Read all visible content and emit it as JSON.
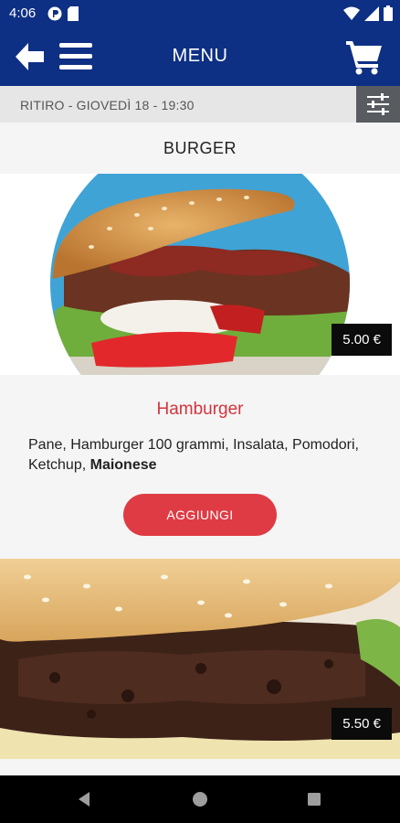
{
  "status_bar": {
    "time": "4:06",
    "left_icons": [
      "notification-icon",
      "sd-card-icon"
    ],
    "right_icons": [
      "wifi-icon",
      "signal-icon",
      "battery-icon"
    ]
  },
  "app_bar": {
    "title": "MENU",
    "background": "#0d2f84"
  },
  "pickup_bar": {
    "text": "RITIRO - GIOVEDÌ 18 - 19:30"
  },
  "category": {
    "title": "BURGER"
  },
  "products": [
    {
      "name": "Hamburger",
      "price": "5.00 €",
      "description_regular": "Pane, Hamburger 100 grammi, Insalata, Pomodori, Ketchup, ",
      "description_bold": "Maionese",
      "add_label": "AGGIUNGI"
    },
    {
      "price": "5.50 €"
    }
  ],
  "colors": {
    "accent": "#df3b45",
    "product_name": "#d4343d",
    "primary": "#0d2f84"
  },
  "nav_bar": {
    "buttons": [
      "back-icon",
      "home-icon",
      "recents-icon"
    ]
  }
}
